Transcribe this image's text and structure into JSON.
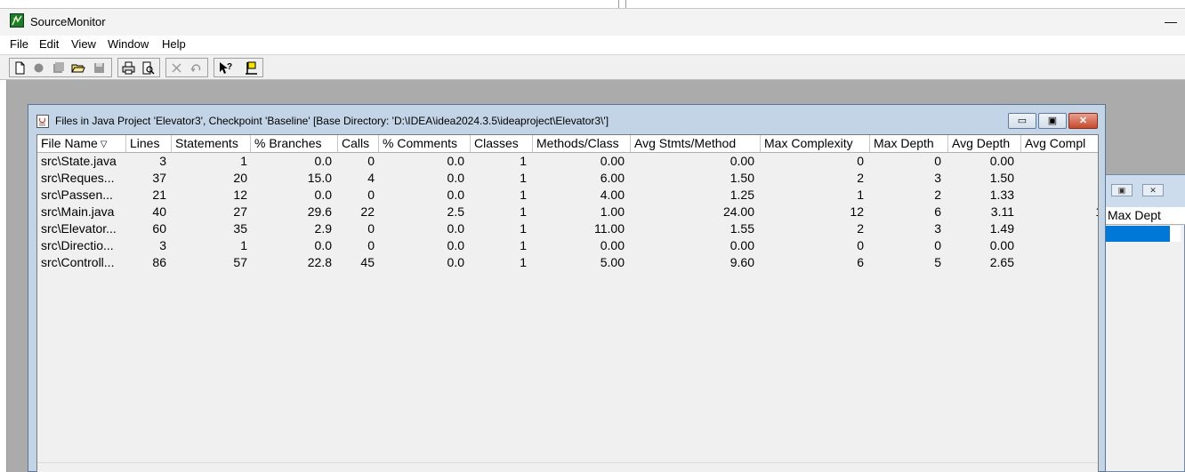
{
  "app": {
    "title": "SourceMonitor",
    "minimize_glyph": "—"
  },
  "menu": [
    {
      "label": "File"
    },
    {
      "label": "Edit"
    },
    {
      "label": "View"
    },
    {
      "label": "Window"
    },
    {
      "label": "Help"
    }
  ],
  "toolbar": {
    "buttons": [
      {
        "icon": "new-file-icon"
      },
      {
        "icon": "record-icon"
      },
      {
        "icon": "stack-icon"
      },
      {
        "icon": "open-folder-icon"
      },
      {
        "icon": "save-icon"
      },
      {
        "icon": "print-icon"
      },
      {
        "icon": "print-preview-icon"
      },
      {
        "icon": "delete-icon"
      },
      {
        "icon": "undo-icon"
      },
      {
        "icon": "help-context-icon"
      },
      {
        "icon": "flag-icon"
      }
    ]
  },
  "child_window": {
    "title": "Files in Java Project 'Elevator3', Checkpoint 'Baseline'  [Base Directory: 'D:\\IDEA\\idea2024.3.5\\ideaproject\\Elevator3\\']",
    "minimize_glyph": "▭",
    "maximize_glyph": "▣",
    "close_glyph": "✕"
  },
  "table": {
    "sort_glyph": "▽",
    "columns": [
      {
        "label": "File Name"
      },
      {
        "label": "Lines"
      },
      {
        "label": "Statements"
      },
      {
        "label": "% Branches"
      },
      {
        "label": "Calls"
      },
      {
        "label": "% Comments"
      },
      {
        "label": "Classes"
      },
      {
        "label": "Methods/Class"
      },
      {
        "label": "Avg Stmts/Method"
      },
      {
        "label": "Max Complexity"
      },
      {
        "label": "Max Depth"
      },
      {
        "label": "Avg Depth"
      },
      {
        "label": "Avg Compl"
      }
    ],
    "rows": [
      [
        "src\\State.java",
        "3",
        "1",
        "0.0",
        "0",
        "0.0",
        "1",
        "0.00",
        "0.00",
        "0",
        "0",
        "0.00",
        "("
      ],
      [
        "src\\Reques...",
        "37",
        "20",
        "15.0",
        "4",
        "0.0",
        "1",
        "6.00",
        "1.50",
        "2",
        "3",
        "1.50",
        ""
      ],
      [
        "src\\Passen...",
        "21",
        "12",
        "0.0",
        "0",
        "0.0",
        "1",
        "4.00",
        "1.25",
        "1",
        "2",
        "1.33",
        ""
      ],
      [
        "src\\Main.java",
        "40",
        "27",
        "29.6",
        "22",
        "2.5",
        "1",
        "1.00",
        "24.00",
        "12",
        "6",
        "3.11",
        "1."
      ],
      [
        "src\\Elevator...",
        "60",
        "35",
        "2.9",
        "0",
        "0.0",
        "1",
        "11.00",
        "1.55",
        "2",
        "3",
        "1.49",
        ""
      ],
      [
        "src\\Directio...",
        "3",
        "1",
        "0.0",
        "0",
        "0.0",
        "1",
        "0.00",
        "0.00",
        "0",
        "0",
        "0.00",
        "("
      ],
      [
        "src\\Controll...",
        "86",
        "57",
        "22.8",
        "45",
        "0.0",
        "1",
        "5.00",
        "9.60",
        "6",
        "5",
        "2.65",
        ":"
      ]
    ]
  },
  "second_window": {
    "header": "Max Dept",
    "restore_glyph": "▣",
    "close_glyph": "✕"
  }
}
